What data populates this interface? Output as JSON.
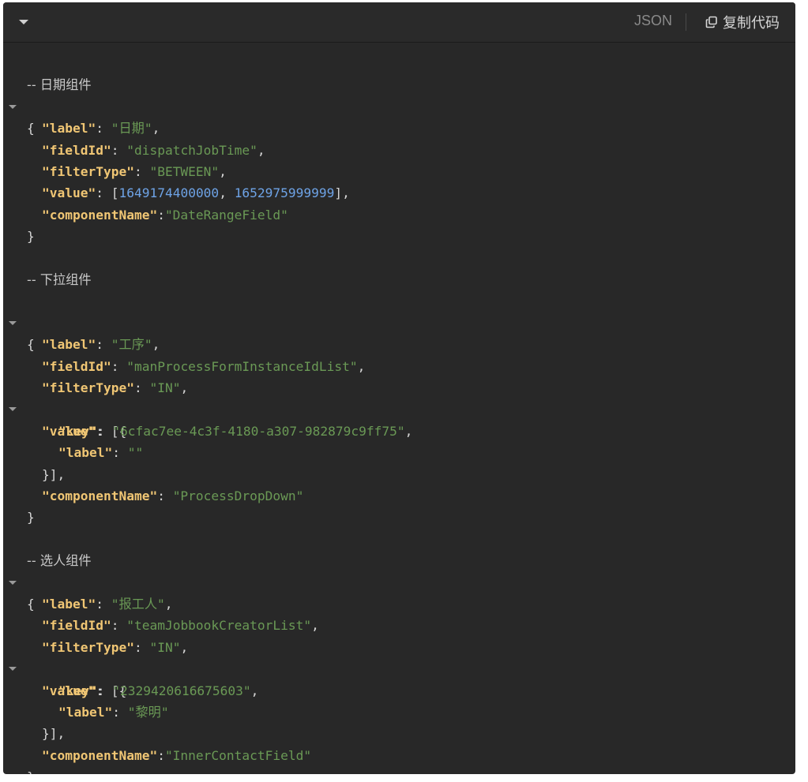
{
  "toolbar": {
    "language": "JSON",
    "copy_label": "复制代码",
    "icons": {
      "collapse": "caret-down-icon",
      "copy": "copy-icon"
    }
  },
  "colors": {
    "background": "#282828",
    "key": "#f0c674",
    "string": "#6a9955",
    "number": "#6ea3e6",
    "punctuation": "#d6d6d6"
  },
  "blocks": {
    "date": {
      "comment": "-- 日期组件",
      "label_key": "\"label\"",
      "label_val": "\"日期\"",
      "fieldId_key": "\"fieldId\"",
      "fieldId_val": "\"dispatchJobTime\"",
      "filterType_key": "\"filterType\"",
      "filterType_val": "\"BETWEEN\"",
      "value_key": "\"value\"",
      "value_num1": "1649174400000",
      "value_num2": "1652975999999",
      "componentName_key": "\"componentName\"",
      "componentName_val": "\"DateRangeField\""
    },
    "dropdown": {
      "comment": "-- 下拉组件",
      "label_key": "\"label\"",
      "label_val": "\"工序\"",
      "fieldId_key": "\"fieldId\"",
      "fieldId_val": "\"manProcessFormInstanceIdList\"",
      "filterType_key": "\"filterType\"",
      "filterType_val": "\"IN\"",
      "value_key": "\"value\"",
      "item_key_key": "\"key\"",
      "item_key_val": "\"6cfac7ee-4c3f-4180-a307-982879c9ff75\"",
      "item_label_key": "\"label\"",
      "item_label_val": "\"\"",
      "componentName_key": "\"componentName\"",
      "componentName_val": "\"ProcessDropDown\""
    },
    "person": {
      "comment": "-- 选人组件",
      "label_key": "\"label\"",
      "label_val": "\"报工人\"",
      "fieldId_key": "\"fieldId\"",
      "fieldId_val": "\"teamJobbookCreatorList\"",
      "filterType_key": "\"filterType\"",
      "filterType_val": "\"IN\"",
      "value_key": "\"value\"",
      "item_key_key": "\"key\"",
      "item_key_val": "\"2329420616675603\"",
      "item_label_key": "\"label\"",
      "item_label_val": "\"黎明\"",
      "componentName_key": "\"componentName\"",
      "componentName_val": "\"InnerContactField\""
    }
  }
}
